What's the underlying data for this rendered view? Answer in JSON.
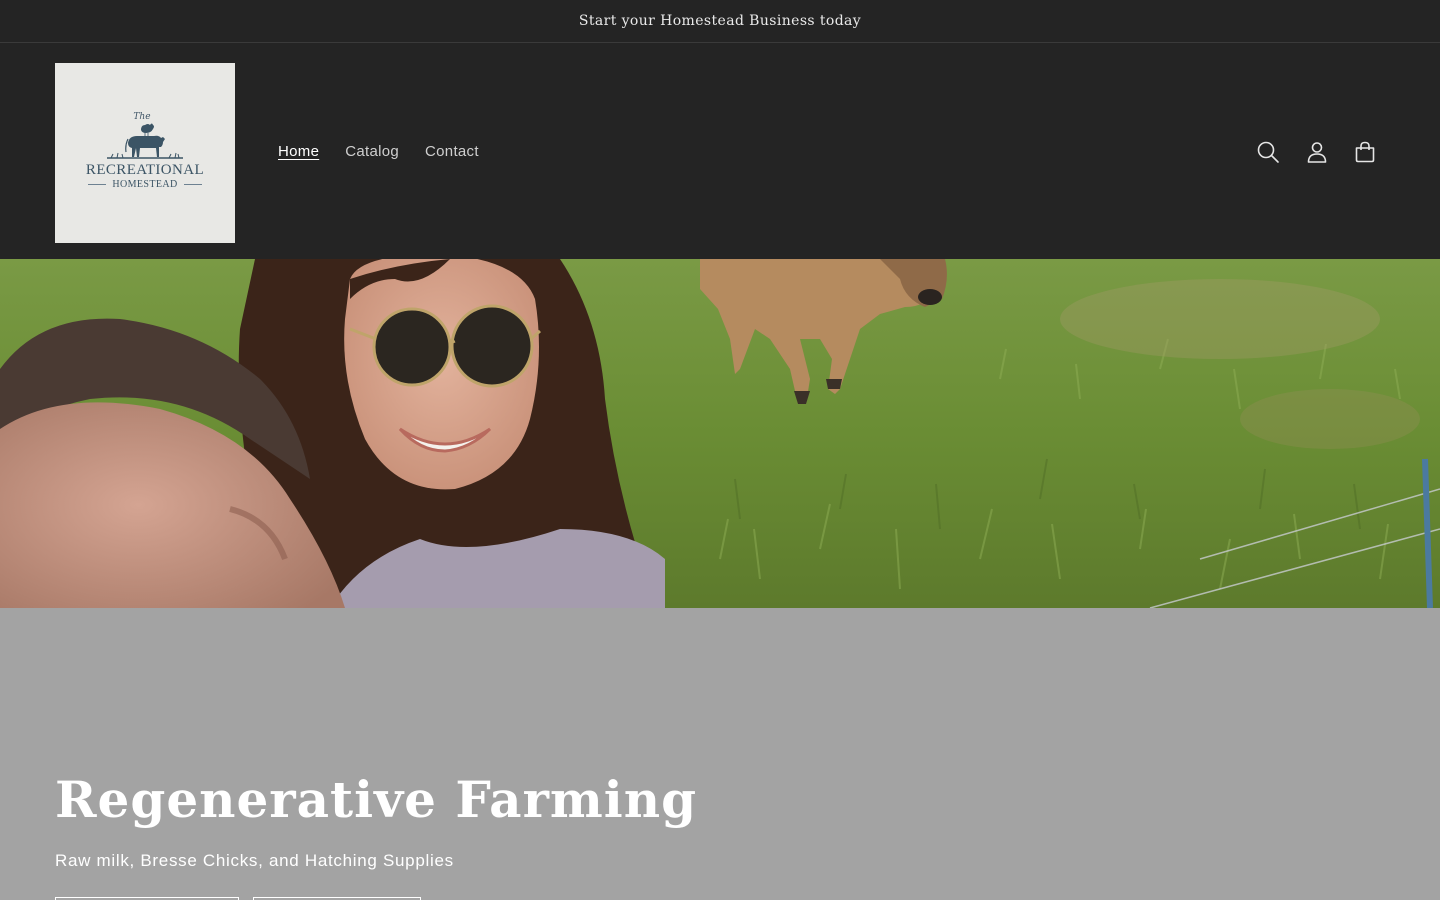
{
  "announcement": {
    "text": "Start your Homestead Business today"
  },
  "logo": {
    "the": "The",
    "main": "RECREATIONAL",
    "sub": "HOMESTEAD"
  },
  "nav": {
    "items": [
      {
        "label": "Home",
        "active": true
      },
      {
        "label": "Catalog",
        "active": false
      },
      {
        "label": "Contact",
        "active": false
      }
    ]
  },
  "header_icons": [
    "search-icon",
    "account-icon",
    "cart-icon"
  ],
  "hero": {
    "title": "Regenerative Farming",
    "subtitle": "Raw milk, Bresse Chicks, and Hatching Supplies"
  },
  "colors": {
    "header_bg": "#242424",
    "logo_bg": "#e8e8e5",
    "logo_ink": "#3b5465",
    "hero_content_bg": "#a3a3a3",
    "text_light": "#ffffff"
  }
}
